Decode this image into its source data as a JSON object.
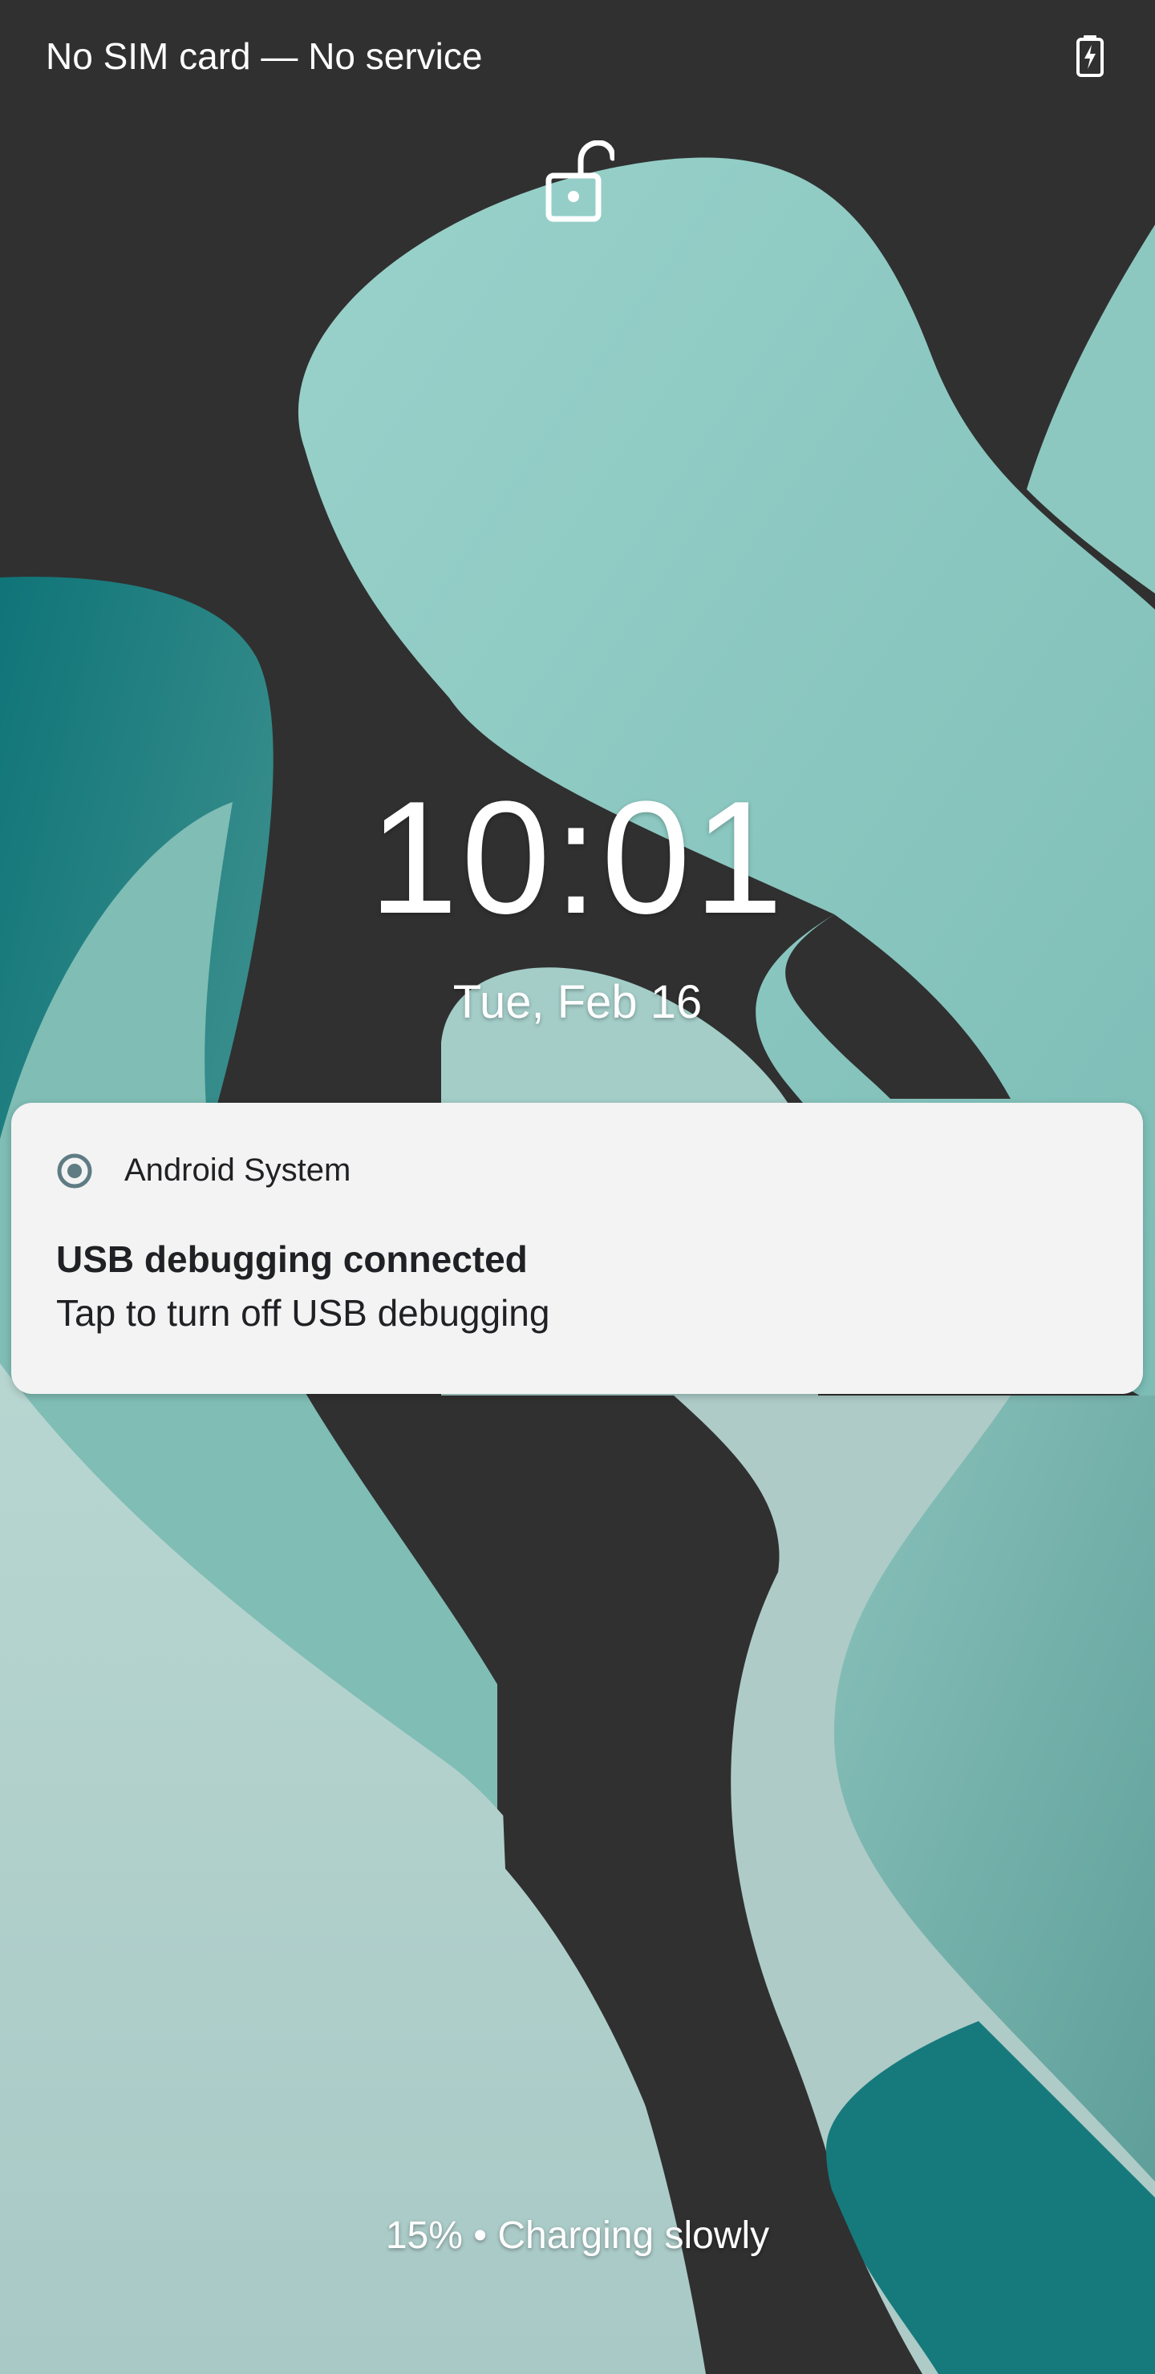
{
  "status_bar": {
    "carrier_text": "No SIM card — No service",
    "battery_icon": "battery-charging-icon"
  },
  "lock_screen": {
    "lock_icon": "unlocked-padlock-icon",
    "time": "10:01",
    "date": "Tue, Feb 16",
    "charging_status": "15% • Charging slowly",
    "battery_percent": 15
  },
  "notification": {
    "app_icon": "android-system-icon",
    "app_name": "Android System",
    "title": "USB debugging connected",
    "text": "Tap to turn off USB debugging"
  },
  "colors": {
    "background_dark": "#303030",
    "wallpaper_light_teal": "#8ec9c2",
    "wallpaper_mint": "#b3d0cc",
    "wallpaper_deep_teal": "#0f7478",
    "notification_bg": "#f3f3f3",
    "app_icon_color": "#5f7b83"
  }
}
